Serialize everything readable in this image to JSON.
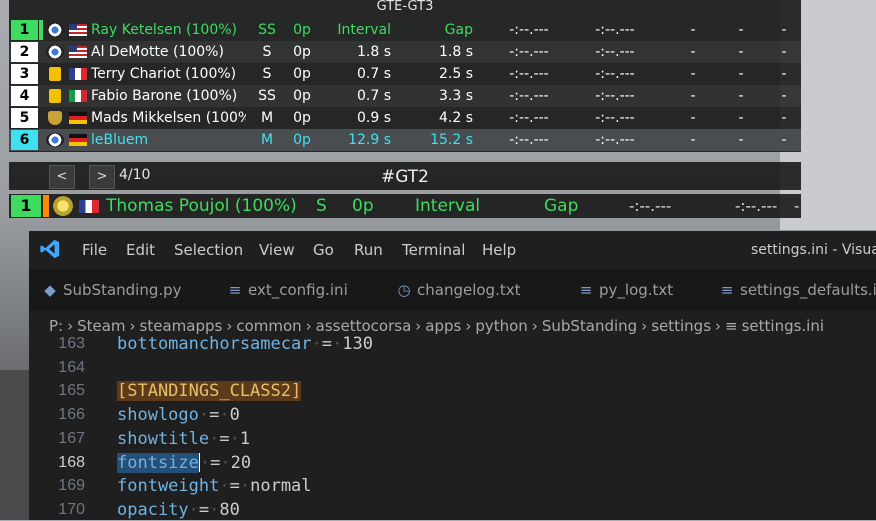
{
  "standings": {
    "class_name": "GTE-GT3",
    "rows": [
      {
        "pos": "1",
        "brand": "bmw",
        "flag": "us",
        "name": "Ray Ketelsen (100%)",
        "cls": "SS",
        "pits": "0p",
        "interval": "Interval",
        "gap": "Gap",
        "t1": "-:--.---",
        "t2": "-:--.---",
        "d1": "-",
        "d2": "-",
        "d3": "-"
      },
      {
        "pos": "2",
        "brand": "bmw",
        "flag": "us",
        "name": "Al DeMotte (100%)",
        "cls": "S",
        "pits": "0p",
        "interval": "1.8 s",
        "gap": "1.8 s",
        "t1": "-:--.---",
        "t2": "-:--.---",
        "d1": "-",
        "d2": "-",
        "d3": "-"
      },
      {
        "pos": "3",
        "brand": "ferrari",
        "flag": "fr",
        "name": "Terry Chariot (100%)",
        "cls": "S",
        "pits": "0p",
        "interval": "0.7 s",
        "gap": "2.5 s",
        "t1": "-:--.---",
        "t2": "-:--.---",
        "d1": "-",
        "d2": "-",
        "d3": "-"
      },
      {
        "pos": "4",
        "brand": "ferrari",
        "flag": "it",
        "name": "Fabio Barone (100%)",
        "cls": "SS",
        "pits": "0p",
        "interval": "0.7 s",
        "gap": "3.3 s",
        "t1": "-:--.---",
        "t2": "-:--.---",
        "d1": "-",
        "d2": "-",
        "d3": "-"
      },
      {
        "pos": "5",
        "brand": "lambo",
        "flag": "de",
        "name": "Mads Mikkelsen (100%",
        "cls": "M",
        "pits": "0p",
        "interval": "0.9 s",
        "gap": "4.2 s",
        "t1": "-:--.---",
        "t2": "-:--.---",
        "d1": "-",
        "d2": "-",
        "d3": "-"
      },
      {
        "pos": "6",
        "brand": "bmw",
        "flag": "de",
        "name": "leBluem",
        "cls": "M",
        "pits": "0p",
        "interval": "12.9 s",
        "gap": "15.2 s",
        "t1": "-:--.---",
        "t2": "-:--.---",
        "d1": "-",
        "d2": "-",
        "d3": "-"
      }
    ]
  },
  "pager": {
    "prev": "<",
    "next": ">",
    "page": "4/10",
    "class_title": "#GT2"
  },
  "gt2": {
    "pos": "1",
    "name": "Thomas Poujol (100%)",
    "cls": "S",
    "pits": "0p",
    "interval": "Interval",
    "gap": "Gap",
    "t1": "-:--.---",
    "t2": "-:--.---",
    "d1": "-"
  },
  "vscode": {
    "menu": [
      "File",
      "Edit",
      "Selection",
      "View",
      "Go",
      "Run",
      "Terminal",
      "Help"
    ],
    "window_title": "settings.ini - Visual",
    "tabs": [
      {
        "label": "SubStanding.py",
        "icon": "python-icon"
      },
      {
        "label": "ext_config.ini",
        "icon": "lines-icon"
      },
      {
        "label": "changelog.txt",
        "icon": "clock-icon"
      },
      {
        "label": "py_log.txt",
        "icon": "lines-icon"
      },
      {
        "label": "settings_defaults.i",
        "icon": "lines-icon"
      }
    ],
    "breadcrumb": [
      "P:",
      "Steam",
      "steamapps",
      "common",
      "assettocorsa",
      "apps",
      "python",
      "SubStanding",
      "settings",
      "settings.ini"
    ],
    "lines": [
      {
        "n": "163",
        "key": "bottomanchorsamecar",
        "val": "130"
      },
      {
        "n": "164",
        "key": "",
        "val": ""
      },
      {
        "n": "165",
        "section": "[STANDINGS_CLASS2]"
      },
      {
        "n": "166",
        "key": "showlogo",
        "val": "0"
      },
      {
        "n": "167",
        "key": "showtitle",
        "val": "1"
      },
      {
        "n": "168",
        "key": "fontsize",
        "val": "20"
      },
      {
        "n": "169",
        "key": "fontweight",
        "val": "normal"
      },
      {
        "n": "170",
        "key": "opacity",
        "val": "80"
      }
    ]
  },
  "colors": {
    "accent_green": "#3ddc5e",
    "accent_cyan": "#40e0f0",
    "vscode_key": "#6fb3e3",
    "vscode_section": "#e6c16a"
  }
}
